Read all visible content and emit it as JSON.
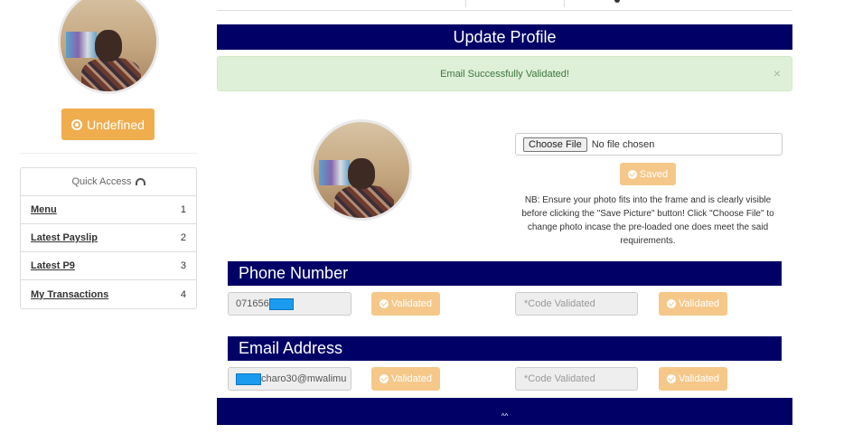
{
  "sidebar": {
    "status_label": "Undefined",
    "quick_access": {
      "title": "Quick Access",
      "items": [
        {
          "label": "Menu",
          "count": "1"
        },
        {
          "label": "Latest Payslip",
          "count": "2"
        },
        {
          "label": "Latest P9",
          "count": "3"
        },
        {
          "label": "My Transactions",
          "count": "4"
        }
      ]
    }
  },
  "main": {
    "title": "Update Profile",
    "alert": {
      "message": "Email Successfully Validated!",
      "close": "×"
    },
    "photo_upload": {
      "choose_label": "Choose File",
      "file_status": "No file chosen",
      "saved_label": "Saved",
      "note": "NB: Ensure your photo fits into the frame and is clearly visible before clicking the \"Save Picture\" button! Click \"Choose File\" to change photo incase the pre-loaded one does meet the said requirements."
    },
    "phone": {
      "heading": "Phone Number",
      "value": "071656",
      "validated_label": "Validated",
      "code_placeholder": "*Code Validated",
      "code_validated_label": "Validated"
    },
    "email": {
      "heading": "Email Address",
      "value": "charo30@mwalimu",
      "validated_label": "Validated",
      "code_placeholder": "*Code Validated",
      "code_validated_label": "Validated"
    },
    "footer_text": "^^"
  },
  "colors": {
    "navy": "#000066",
    "warning": "#f0ad4e",
    "warning_light": "#f5c88a",
    "success_bg": "#dff0d8",
    "success_text": "#3c763d",
    "redaction": "#1b9bf0"
  },
  "icons": [
    "close-circle-icon",
    "dashboard-gauge-icon",
    "check-circle-icon",
    "close-icon"
  ]
}
